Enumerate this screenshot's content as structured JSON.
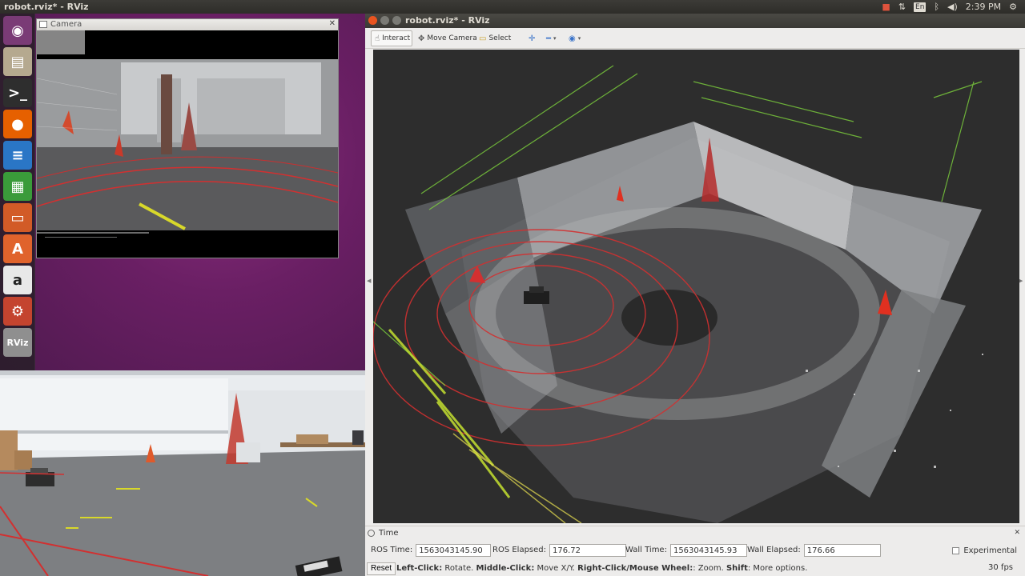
{
  "top_panel": {
    "title": "robot.rviz* - RViz",
    "language_badge": "En",
    "clock": "2:39 PM"
  },
  "launcher": {
    "items": [
      {
        "name": "ubuntu-dash-icon",
        "glyph": "◉",
        "color": "#7a3b76"
      },
      {
        "name": "files-icon",
        "glyph": "▤",
        "color": "#b5a98f"
      },
      {
        "name": "terminal-icon",
        "glyph": ">_",
        "color": "#2e2e2e"
      },
      {
        "name": "firefox-icon",
        "glyph": "●",
        "color": "#e66000"
      },
      {
        "name": "writer-icon",
        "glyph": "≡",
        "color": "#2a76c6"
      },
      {
        "name": "calc-icon",
        "glyph": "▦",
        "color": "#3a9b3a"
      },
      {
        "name": "impress-icon",
        "glyph": "▭",
        "color": "#d25b27"
      },
      {
        "name": "software-center-icon",
        "glyph": "A",
        "color": "#e0632c"
      },
      {
        "name": "amazon-icon",
        "glyph": "a",
        "color": "#e8e8e8"
      },
      {
        "name": "settings-icon",
        "glyph": "⚙",
        "color": "#c4442f"
      },
      {
        "name": "rviz-icon",
        "glyph": "RViz",
        "color": "#8f8f8f"
      }
    ]
  },
  "camera_window": {
    "title": "Camera"
  },
  "rviz": {
    "title": "robot.rviz* - RViz",
    "tools": {
      "interact": "Interact",
      "move_camera": "Move Camera",
      "select": "Select"
    },
    "time_panel": {
      "title": "Time",
      "ros_time_label": "ROS Time:",
      "ros_time_value": "1563043145.90",
      "ros_elapsed_label": "ROS Elapsed:",
      "ros_elapsed_value": "176.72",
      "wall_time_label": "Wall Time:",
      "wall_time_value": "1563043145.93",
      "wall_elapsed_label": "Wall Elapsed:",
      "wall_elapsed_value": "176.66",
      "experimental_label": "Experimental"
    },
    "status_bar": {
      "reset_label": "Reset",
      "left_click": "Left-Click:",
      "left_click_action": " Rotate. ",
      "middle_click": "Middle-Click:",
      "middle_click_action": " Move X/Y. ",
      "right_click": "Right-Click/Mouse Wheel:",
      "right_click_action": ": Zoom. ",
      "shift": "Shift",
      "shift_action": ": More options.",
      "fps": "30 fps"
    }
  },
  "colors": {
    "desktop_purple": "#6a1f64",
    "viewport_bg": "#2d2d2d",
    "laser_red": "#d23030",
    "pointcloud_green": "#7ed33c"
  }
}
